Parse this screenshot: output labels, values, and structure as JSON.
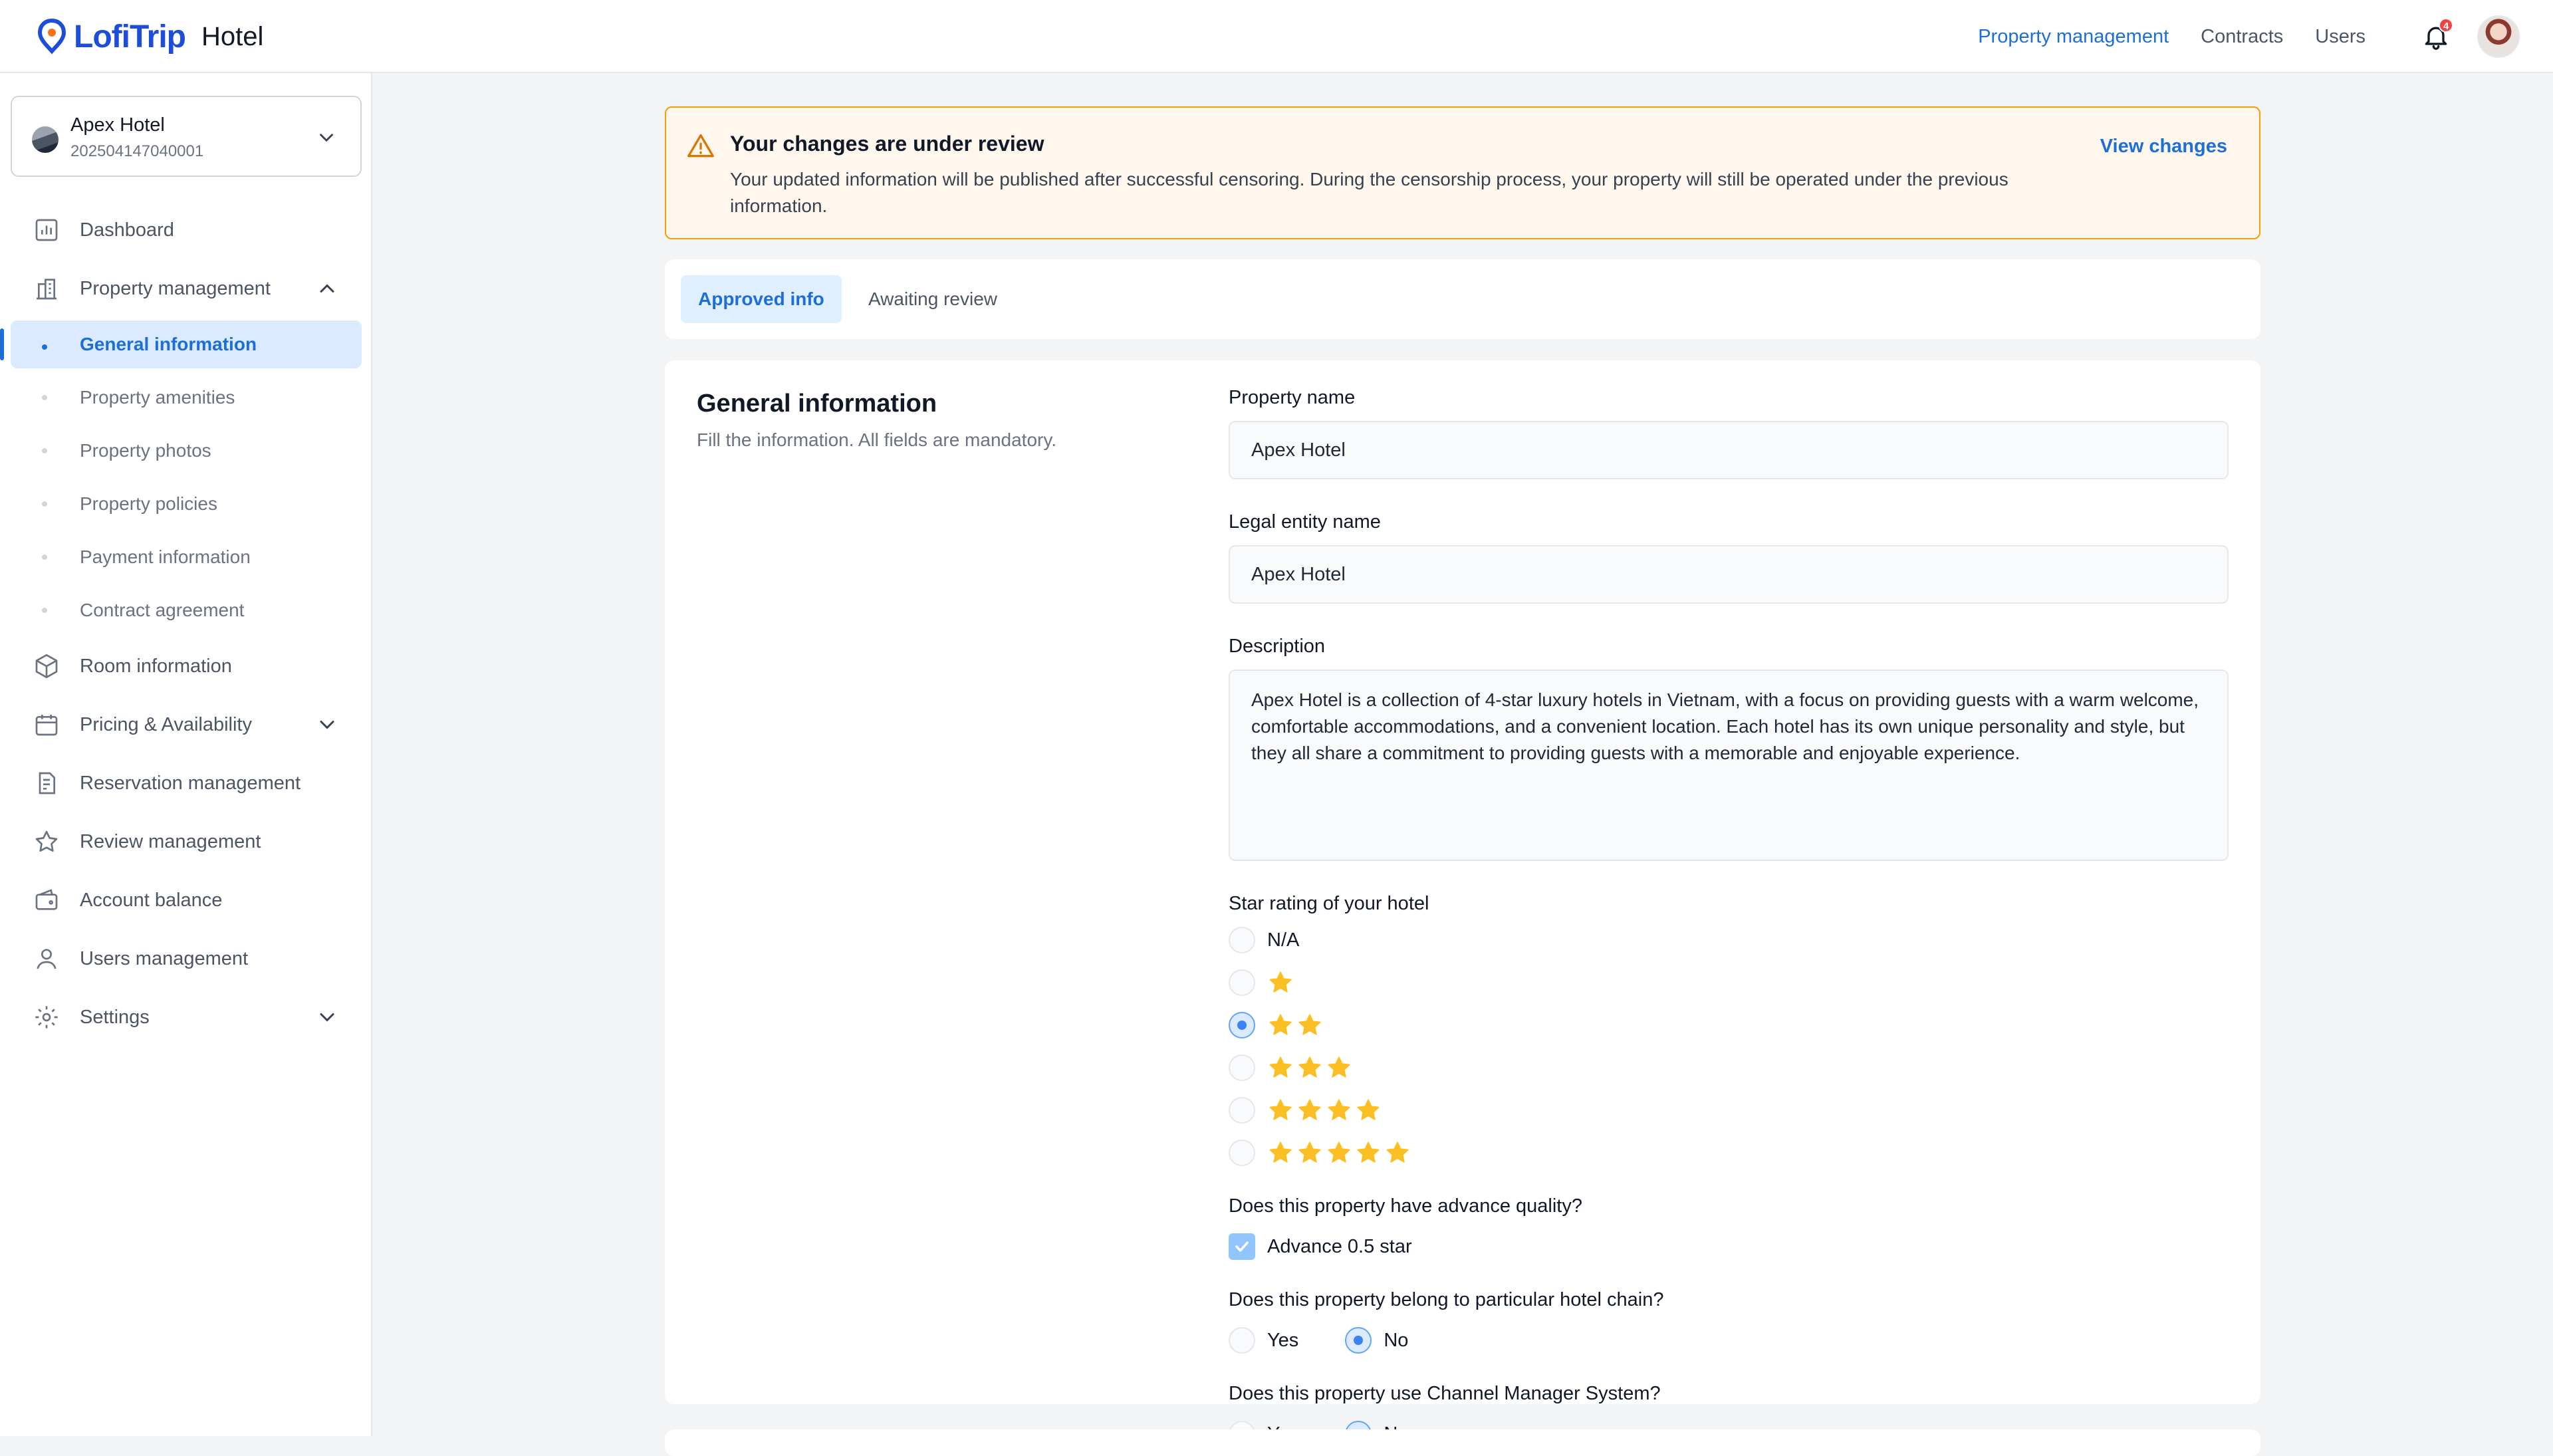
{
  "app": {
    "logo_text": "LofiTrip",
    "product": "Hotel"
  },
  "topnav": {
    "items": [
      "Property management",
      "Contracts",
      "Users"
    ],
    "notification_count": "4"
  },
  "sidebar": {
    "hotel_name": "Apex Hotel",
    "hotel_code": "202504147040001",
    "menu": {
      "dashboard": "Dashboard",
      "property_management": "Property management",
      "sub": [
        "General information",
        "Property amenities",
        "Property photos",
        "Property policies",
        "Payment information",
        "Contract agreement"
      ],
      "room_information": "Room information",
      "pricing": "Pricing & Availability",
      "reservation": "Reservation management",
      "review": "Review management",
      "account_balance": "Account balance",
      "users": "Users management",
      "settings": "Settings"
    }
  },
  "banner": {
    "title": "Your changes are under review",
    "text": "Your updated information will be published after successful censoring. During the censorship process, your property will still be operated under the previous information.",
    "action": "View changes"
  },
  "tabs": [
    "Approved info",
    "Awaiting review"
  ],
  "card": {
    "title": "General information",
    "subtitle": "Fill the information. All fields are mandatory.",
    "property_name_label": "Property name",
    "property_name": "Apex Hotel",
    "legal_label": "Legal entity name",
    "legal_name": "Apex Hotel",
    "description_label": "Description",
    "description": "Apex Hotel is a collection of 4-star luxury hotels in Vietnam, with a focus on providing guests with a warm welcome, comfortable accommodations, and a convenient location. Each hotel has its own unique personality and style, but they all share a commitment to providing guests with a memorable and enjoyable experience.",
    "star_label": "Star rating of your hotel",
    "star_na": "N/A",
    "star_selected": 2,
    "advance_q": "Does this property have advance quality?",
    "advance_opt": "Advance 0.5 star",
    "chain_q": "Does this property belong to particular hotel chain?",
    "channel_q": "Does this property use Channel Manager System?",
    "yes": "Yes",
    "no": "No"
  },
  "colors": {
    "accent": "#1d6fd8",
    "star": "#fbbf24",
    "warning": "#f59e0b"
  }
}
